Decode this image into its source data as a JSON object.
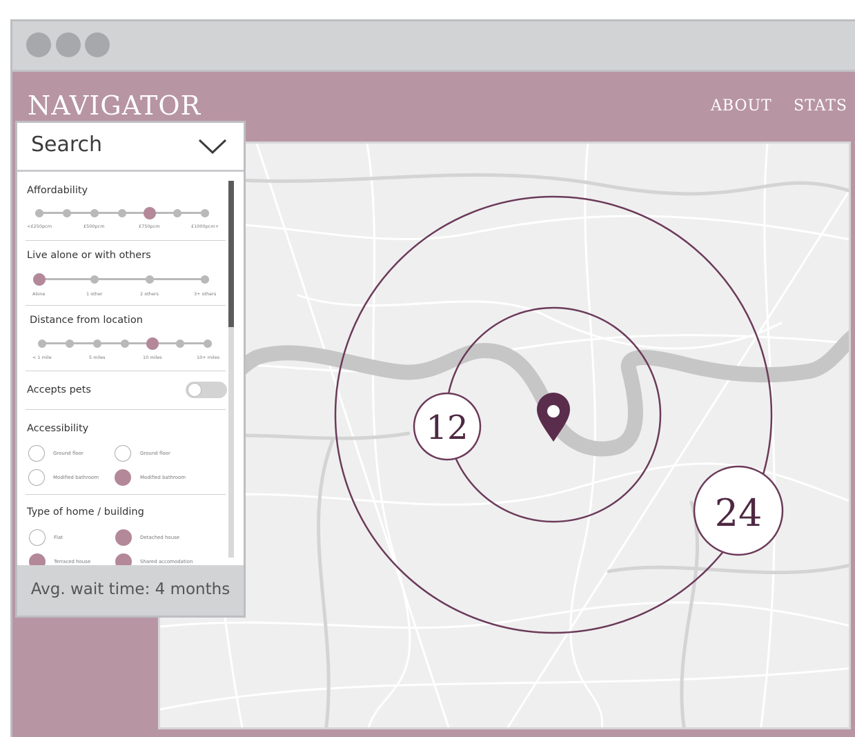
{
  "header": {
    "logo": "NAVIGATOR",
    "nav": [
      "ABOUT",
      "STATS"
    ]
  },
  "search": {
    "label": "Search"
  },
  "filters": {
    "affordability": {
      "title": "Affordability",
      "ticks": [
        "<£250pcm",
        "£500pcm",
        "£750pcm",
        "£1000pcm+"
      ],
      "stops": 7,
      "selected_index": 4
    },
    "live_with": {
      "title": "Live alone or with others",
      "ticks": [
        "Alone",
        "1 other",
        "2 others",
        "3+ others"
      ],
      "stops": 4,
      "selected_index": 0
    },
    "distance": {
      "title": "Distance from location",
      "ticks": [
        "< 1 mile",
        "5 miles",
        "10 miles",
        "10+ miles"
      ],
      "stops": 7,
      "selected_index": 4
    },
    "pets": {
      "title": "Accepts pets",
      "on": false
    },
    "accessibility": {
      "title": "Accessibility",
      "options": [
        {
          "label": "Ground floor",
          "checked": false
        },
        {
          "label": "Ground floor",
          "checked": false
        },
        {
          "label": "Modified bathroom",
          "checked": false
        },
        {
          "label": "Modified bathroom",
          "checked": true
        }
      ]
    },
    "home_type": {
      "title": "Type of home / building",
      "options": [
        {
          "label": "Flat",
          "checked": false
        },
        {
          "label": "Detached house",
          "checked": true
        },
        {
          "label": "Terraced house",
          "checked": true
        },
        {
          "label": "Shared accomodation",
          "checked": true
        }
      ]
    }
  },
  "wait_time": "Avg. wait time: 4 months",
  "map": {
    "inner_count": "12",
    "outer_count": "24"
  },
  "colors": {
    "brand": "#b895a3",
    "accent": "#b38899",
    "ring": "#6b3a5a",
    "pin": "#5b2d4c"
  },
  "icons": {
    "dropdown": "chevron-down-icon",
    "location": "map-pin-icon"
  }
}
